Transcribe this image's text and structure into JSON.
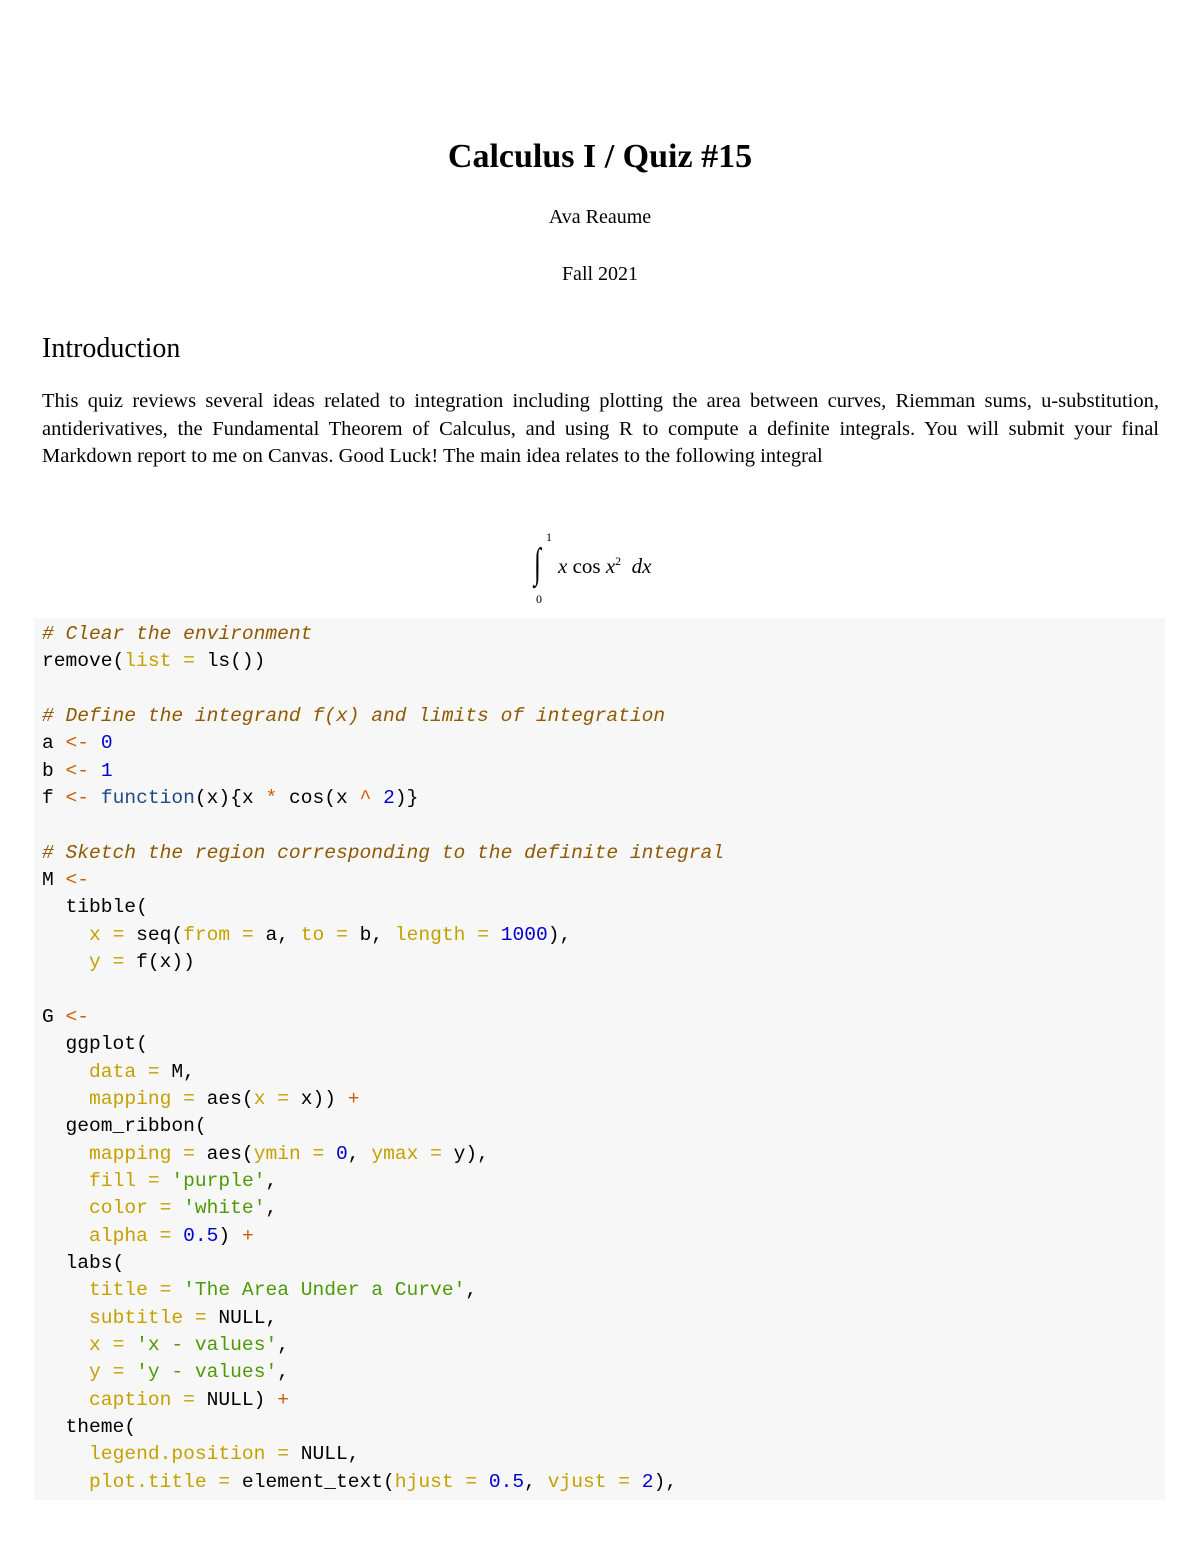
{
  "document": {
    "title": "Calculus I / Quiz #15",
    "author": "Ava Reaume",
    "date": "Fall 2021"
  },
  "sections": [
    {
      "heading": "Introduction",
      "paragraph": "This quiz reviews several ideas related to integration including plotting the area between curves, Riemman sums, u-substitution, antiderivatives, the Fundamental Theorem of Calculus, and using R to compute a definite integrals. You will submit your final Markdown report to me on Canvas. Good Luck! The main idea relates to the following integral"
    }
  ],
  "equation": {
    "integral_symbol": "∫",
    "lower_limit": "0",
    "upper_limit": "1",
    "integrand_x": "x",
    "integrand_cos": " cos ",
    "integrand_x2": "x",
    "exponent": "2",
    "differential": "dx"
  },
  "code": {
    "language": "r",
    "colors": {
      "comment": "#8f5902",
      "argument": "#c4a000",
      "number": "#0000cf",
      "keyword": "#204a87",
      "string": "#4e9a06",
      "operator": "#ce5c00",
      "background": "#f7f7f7"
    },
    "lines": [
      [
        {
          "t": "comment",
          "v": "# Clear the environment"
        }
      ],
      [
        {
          "t": "plain",
          "v": "remove("
        },
        {
          "t": "arg",
          "v": "list"
        },
        {
          "t": "plain",
          "v": " "
        },
        {
          "t": "arg",
          "v": "="
        },
        {
          "t": "plain",
          "v": " ls())"
        }
      ],
      [],
      [
        {
          "t": "comment",
          "v": "# Define the integrand f(x) and limits of integration"
        }
      ],
      [
        {
          "t": "plain",
          "v": "a "
        },
        {
          "t": "op",
          "v": "<-"
        },
        {
          "t": "plain",
          "v": " "
        },
        {
          "t": "num",
          "v": "0"
        }
      ],
      [
        {
          "t": "plain",
          "v": "b "
        },
        {
          "t": "op",
          "v": "<-"
        },
        {
          "t": "plain",
          "v": " "
        },
        {
          "t": "num",
          "v": "1"
        }
      ],
      [
        {
          "t": "plain",
          "v": "f "
        },
        {
          "t": "op",
          "v": "<-"
        },
        {
          "t": "plain",
          "v": " "
        },
        {
          "t": "kw",
          "v": "function"
        },
        {
          "t": "plain",
          "v": "(x){x "
        },
        {
          "t": "op",
          "v": "*"
        },
        {
          "t": "plain",
          "v": " cos(x "
        },
        {
          "t": "op",
          "v": "^"
        },
        {
          "t": "plain",
          "v": " "
        },
        {
          "t": "num",
          "v": "2"
        },
        {
          "t": "plain",
          "v": ")}"
        }
      ],
      [],
      [
        {
          "t": "comment",
          "v": "# Sketch the region corresponding to the definite integral"
        }
      ],
      [
        {
          "t": "plain",
          "v": "M "
        },
        {
          "t": "op",
          "v": "<-"
        }
      ],
      [
        {
          "t": "plain",
          "v": "  tibble("
        }
      ],
      [
        {
          "t": "plain",
          "v": "    "
        },
        {
          "t": "arg",
          "v": "x"
        },
        {
          "t": "plain",
          "v": " "
        },
        {
          "t": "arg",
          "v": "="
        },
        {
          "t": "plain",
          "v": " seq("
        },
        {
          "t": "arg",
          "v": "from"
        },
        {
          "t": "plain",
          "v": " "
        },
        {
          "t": "arg",
          "v": "="
        },
        {
          "t": "plain",
          "v": " a, "
        },
        {
          "t": "arg",
          "v": "to"
        },
        {
          "t": "plain",
          "v": " "
        },
        {
          "t": "arg",
          "v": "="
        },
        {
          "t": "plain",
          "v": " b, "
        },
        {
          "t": "arg",
          "v": "length"
        },
        {
          "t": "plain",
          "v": " "
        },
        {
          "t": "arg",
          "v": "="
        },
        {
          "t": "plain",
          "v": " "
        },
        {
          "t": "num",
          "v": "1000"
        },
        {
          "t": "plain",
          "v": "),"
        }
      ],
      [
        {
          "t": "plain",
          "v": "    "
        },
        {
          "t": "arg",
          "v": "y"
        },
        {
          "t": "plain",
          "v": " "
        },
        {
          "t": "arg",
          "v": "="
        },
        {
          "t": "plain",
          "v": " f(x))"
        }
      ],
      [],
      [
        {
          "t": "plain",
          "v": "G "
        },
        {
          "t": "op",
          "v": "<-"
        }
      ],
      [
        {
          "t": "plain",
          "v": "  ggplot("
        }
      ],
      [
        {
          "t": "plain",
          "v": "    "
        },
        {
          "t": "arg",
          "v": "data"
        },
        {
          "t": "plain",
          "v": " "
        },
        {
          "t": "arg",
          "v": "="
        },
        {
          "t": "plain",
          "v": " M,"
        }
      ],
      [
        {
          "t": "plain",
          "v": "    "
        },
        {
          "t": "arg",
          "v": "mapping"
        },
        {
          "t": "plain",
          "v": " "
        },
        {
          "t": "arg",
          "v": "="
        },
        {
          "t": "plain",
          "v": " aes("
        },
        {
          "t": "arg",
          "v": "x"
        },
        {
          "t": "plain",
          "v": " "
        },
        {
          "t": "arg",
          "v": "="
        },
        {
          "t": "plain",
          "v": " x)) "
        },
        {
          "t": "op",
          "v": "+"
        }
      ],
      [
        {
          "t": "plain",
          "v": "  geom_ribbon("
        }
      ],
      [
        {
          "t": "plain",
          "v": "    "
        },
        {
          "t": "arg",
          "v": "mapping"
        },
        {
          "t": "plain",
          "v": " "
        },
        {
          "t": "arg",
          "v": "="
        },
        {
          "t": "plain",
          "v": " aes("
        },
        {
          "t": "arg",
          "v": "ymin"
        },
        {
          "t": "plain",
          "v": " "
        },
        {
          "t": "arg",
          "v": "="
        },
        {
          "t": "plain",
          "v": " "
        },
        {
          "t": "num",
          "v": "0"
        },
        {
          "t": "plain",
          "v": ", "
        },
        {
          "t": "arg",
          "v": "ymax"
        },
        {
          "t": "plain",
          "v": " "
        },
        {
          "t": "arg",
          "v": "="
        },
        {
          "t": "plain",
          "v": " y),"
        }
      ],
      [
        {
          "t": "plain",
          "v": "    "
        },
        {
          "t": "arg",
          "v": "fill"
        },
        {
          "t": "plain",
          "v": " "
        },
        {
          "t": "arg",
          "v": "="
        },
        {
          "t": "plain",
          "v": " "
        },
        {
          "t": "str",
          "v": "'purple'"
        },
        {
          "t": "plain",
          "v": ","
        }
      ],
      [
        {
          "t": "plain",
          "v": "    "
        },
        {
          "t": "arg",
          "v": "color"
        },
        {
          "t": "plain",
          "v": " "
        },
        {
          "t": "arg",
          "v": "="
        },
        {
          "t": "plain",
          "v": " "
        },
        {
          "t": "str",
          "v": "'white'"
        },
        {
          "t": "plain",
          "v": ","
        }
      ],
      [
        {
          "t": "plain",
          "v": "    "
        },
        {
          "t": "arg",
          "v": "alpha"
        },
        {
          "t": "plain",
          "v": " "
        },
        {
          "t": "arg",
          "v": "="
        },
        {
          "t": "plain",
          "v": " "
        },
        {
          "t": "num",
          "v": "0.5"
        },
        {
          "t": "plain",
          "v": ") "
        },
        {
          "t": "op",
          "v": "+"
        }
      ],
      [
        {
          "t": "plain",
          "v": "  labs("
        }
      ],
      [
        {
          "t": "plain",
          "v": "    "
        },
        {
          "t": "arg",
          "v": "title"
        },
        {
          "t": "plain",
          "v": " "
        },
        {
          "t": "arg",
          "v": "="
        },
        {
          "t": "plain",
          "v": " "
        },
        {
          "t": "str",
          "v": "'The Area Under a Curve'"
        },
        {
          "t": "plain",
          "v": ","
        }
      ],
      [
        {
          "t": "plain",
          "v": "    "
        },
        {
          "t": "arg",
          "v": "subtitle"
        },
        {
          "t": "plain",
          "v": " "
        },
        {
          "t": "arg",
          "v": "="
        },
        {
          "t": "plain",
          "v": " NULL,"
        }
      ],
      [
        {
          "t": "plain",
          "v": "    "
        },
        {
          "t": "arg",
          "v": "x"
        },
        {
          "t": "plain",
          "v": " "
        },
        {
          "t": "arg",
          "v": "="
        },
        {
          "t": "plain",
          "v": " "
        },
        {
          "t": "str",
          "v": "'x - values'"
        },
        {
          "t": "plain",
          "v": ","
        }
      ],
      [
        {
          "t": "plain",
          "v": "    "
        },
        {
          "t": "arg",
          "v": "y"
        },
        {
          "t": "plain",
          "v": " "
        },
        {
          "t": "arg",
          "v": "="
        },
        {
          "t": "plain",
          "v": " "
        },
        {
          "t": "str",
          "v": "'y - values'"
        },
        {
          "t": "plain",
          "v": ","
        }
      ],
      [
        {
          "t": "plain",
          "v": "    "
        },
        {
          "t": "arg",
          "v": "caption"
        },
        {
          "t": "plain",
          "v": " "
        },
        {
          "t": "arg",
          "v": "="
        },
        {
          "t": "plain",
          "v": " NULL) "
        },
        {
          "t": "op",
          "v": "+"
        }
      ],
      [
        {
          "t": "plain",
          "v": "  theme("
        }
      ],
      [
        {
          "t": "plain",
          "v": "    "
        },
        {
          "t": "arg",
          "v": "legend.position"
        },
        {
          "t": "plain",
          "v": " "
        },
        {
          "t": "arg",
          "v": "="
        },
        {
          "t": "plain",
          "v": " NULL,"
        }
      ],
      [
        {
          "t": "plain",
          "v": "    "
        },
        {
          "t": "arg",
          "v": "plot.title"
        },
        {
          "t": "plain",
          "v": " "
        },
        {
          "t": "arg",
          "v": "="
        },
        {
          "t": "plain",
          "v": " element_text("
        },
        {
          "t": "arg",
          "v": "hjust"
        },
        {
          "t": "plain",
          "v": " "
        },
        {
          "t": "arg",
          "v": "="
        },
        {
          "t": "plain",
          "v": " "
        },
        {
          "t": "num",
          "v": "0.5"
        },
        {
          "t": "plain",
          "v": ", "
        },
        {
          "t": "arg",
          "v": "vjust"
        },
        {
          "t": "plain",
          "v": " "
        },
        {
          "t": "arg",
          "v": "="
        },
        {
          "t": "plain",
          "v": " "
        },
        {
          "t": "num",
          "v": "2"
        },
        {
          "t": "plain",
          "v": "),"
        }
      ]
    ]
  }
}
